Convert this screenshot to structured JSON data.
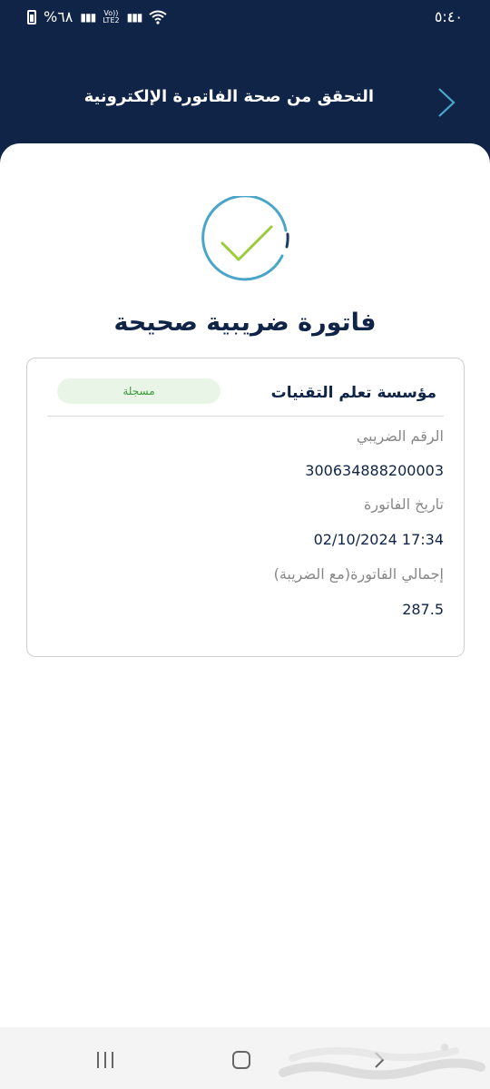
{
  "status_bar": {
    "battery": "%٦٨",
    "network": "LTE2",
    "volte": "Vo))",
    "time": "٥:٤٠"
  },
  "header": {
    "title": "التحقق من صحة الفاتورة الإلكترونية",
    "back_icon": "chevron-right-icon"
  },
  "result": {
    "icon": "check-circle-icon",
    "title": "فاتورة ضريبية صحيحة",
    "colors": {
      "check": "#9ccc3c",
      "ring": "#4aa6c9",
      "title": "#0f2447"
    }
  },
  "invoice": {
    "company": "مؤسسة تعلم التقنيات",
    "status_badge": "مسجلة",
    "tax_number_label": "الرقم الضريبي",
    "tax_number": "300634888200003",
    "date_label": "تاريخ الفاتورة",
    "date": "02/10/2024 17:34",
    "total_label": "إجمالي الفاتورة(مع الضريبة)",
    "total": "287.5"
  },
  "nav_bar": {
    "recent_icon": "recent-apps-icon",
    "home_icon": "home-icon",
    "back_icon": "back-icon"
  },
  "watermark": "حراج"
}
